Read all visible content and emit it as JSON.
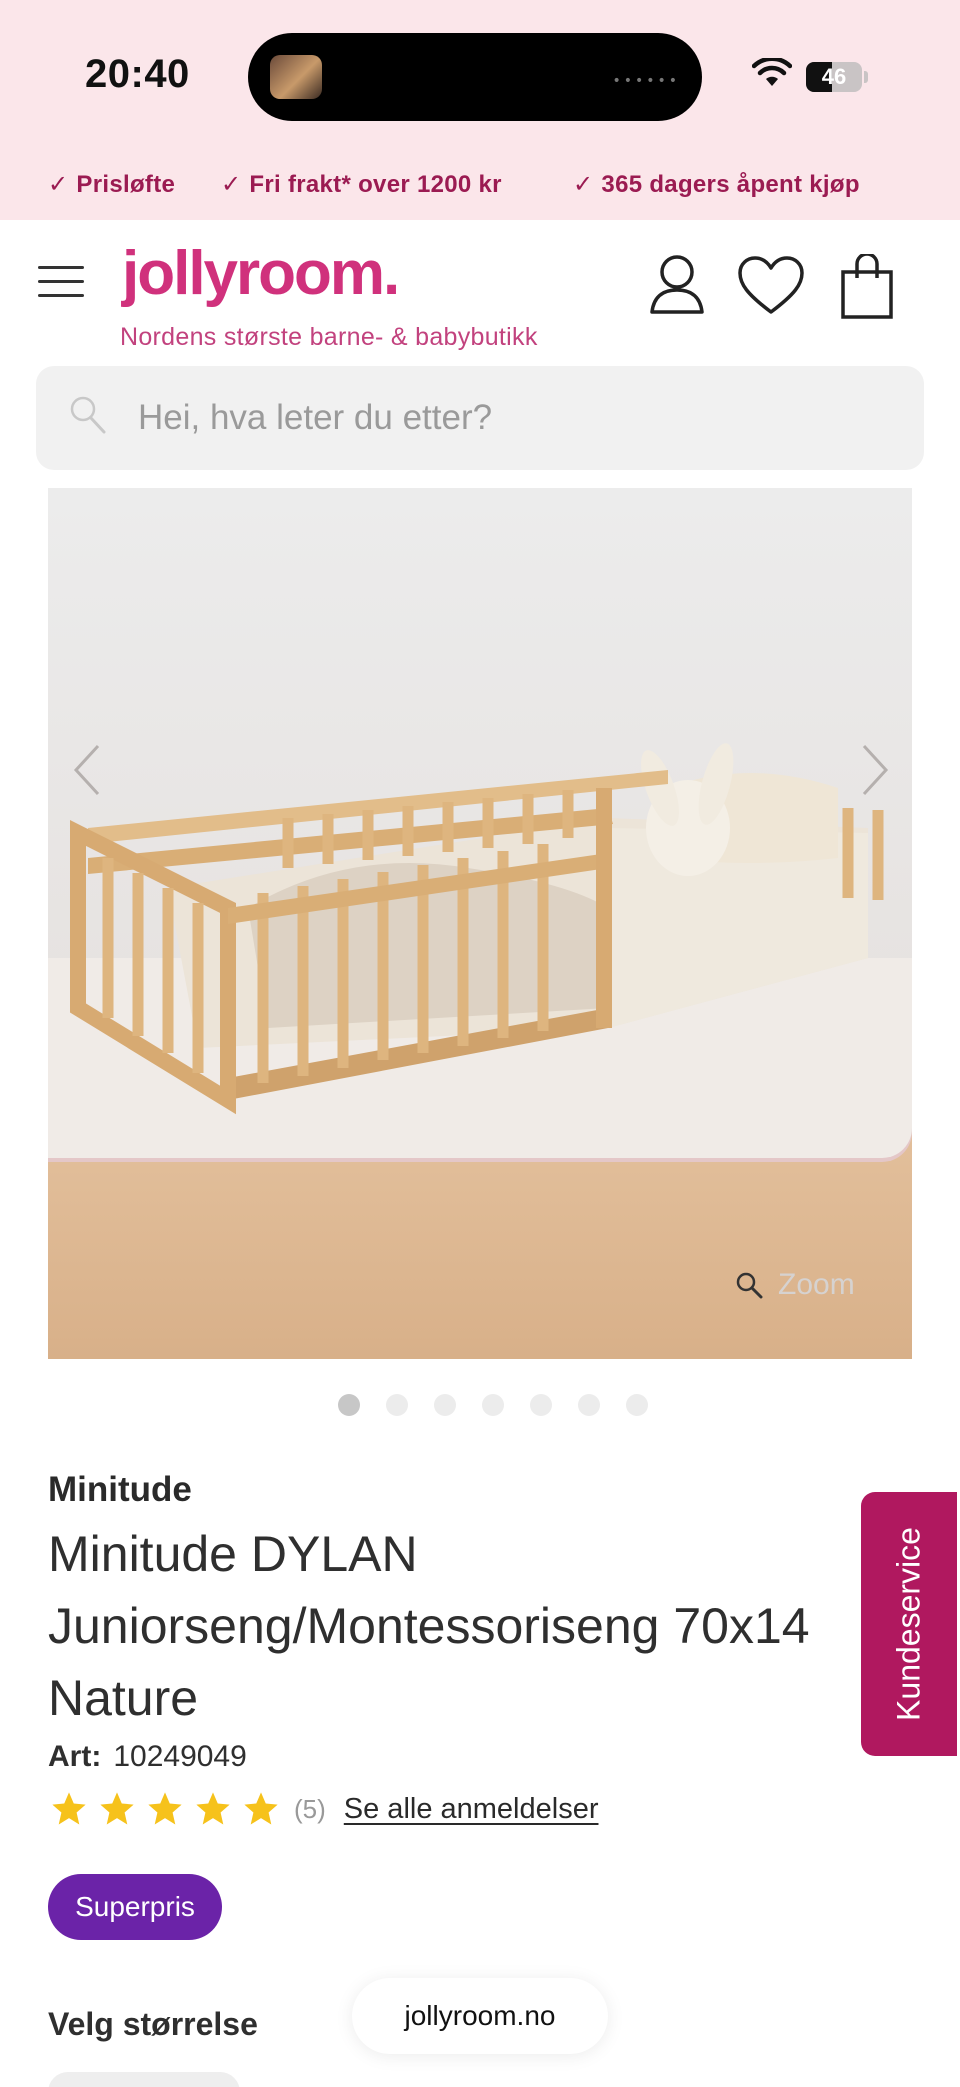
{
  "status_bar": {
    "time": "20:40",
    "battery": "46",
    "battery_level": 0.46
  },
  "usp": [
    {
      "icon": "check-icon",
      "text": "Prisløfte"
    },
    {
      "icon": "check-icon",
      "text": "Fri frakt* over 1200 kr"
    },
    {
      "icon": "check-icon",
      "text": "365 dagers åpent kjøp"
    }
  ],
  "header": {
    "logo": "jollyroom.",
    "tagline": "Nordens største barne- & babybutikk",
    "icons": [
      "menu-icon",
      "account-icon",
      "heart-icon",
      "shopping-bag-icon"
    ]
  },
  "search": {
    "placeholder": "Hei, hva leter du etter?"
  },
  "gallery": {
    "zoom_label": "Zoom",
    "slide_count": 7,
    "active_slide": 1
  },
  "product": {
    "brand": "Minitude",
    "title_lines": [
      "Minitude DYLAN",
      "Juniorseng/Montessoriseng 70x14",
      "Nature"
    ],
    "art_label": "Art:",
    "art_number": "10249049",
    "rating": 5,
    "review_count": "(5)",
    "reviews_link": "Se alle anmeldelser",
    "badge": "Superpris",
    "size_label": "Velg størrelse"
  },
  "floating": {
    "customer_service": "Kundeservice",
    "url": "jollyroom.no"
  },
  "colors": {
    "top_bg": "#fbe6ea",
    "usp_text": "#9b1b52",
    "brand_pink": "#d0317c",
    "badge_purple": "#6b23a8",
    "customer_service_bg": "#b0185f",
    "star": "#f6c21b"
  }
}
